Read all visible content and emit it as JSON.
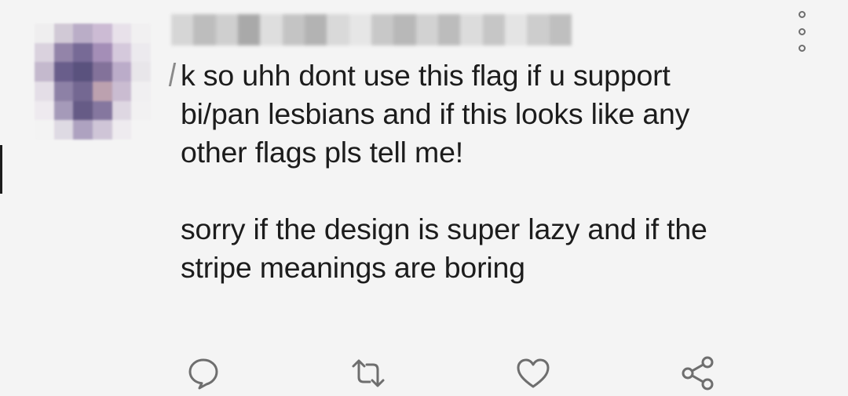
{
  "tweet": {
    "body_lines": [
      "k so uhh dont use this flag if u support",
      "bi/pan lesbians and if this looks like any",
      "other flags pls tell me!"
    ],
    "body_lines_2": [
      "sorry if the design is super lazy and if the",
      "stripe meanings are boring"
    ]
  },
  "icons": {
    "more": "more-options-icon",
    "reply": "reply-icon",
    "retweet": "retweet-icon",
    "like": "heart-icon",
    "share": "share-icon"
  },
  "colors": {
    "background": "#f4f4f4",
    "text": "#1c1c1c",
    "icon": "#6e6e6e"
  }
}
